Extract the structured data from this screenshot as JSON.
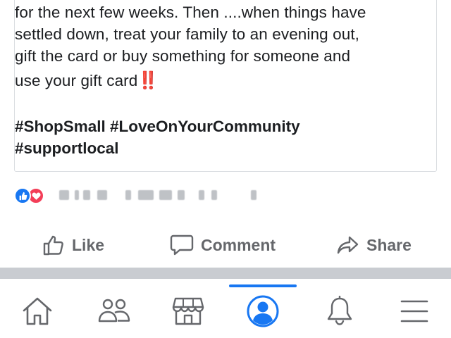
{
  "post": {
    "lines": [
      "for the next few weeks. Then ....when things have",
      "settled down, treat your family to an evening out,",
      "gift the card or buy something for someone and",
      "use your gift card"
    ],
    "emphasis": "‼️",
    "hashtags": [
      "#ShopSmall #LoveOnYourCommunity",
      "#supportlocal"
    ]
  },
  "reactions": {
    "icons": [
      "like-reaction-icon",
      "love-reaction-icon"
    ],
    "colors": {
      "like": "#1877f2",
      "love": "#f33e58"
    }
  },
  "actions": {
    "like_label": "Like",
    "comment_label": "Comment",
    "share_label": "Share"
  },
  "tab_bar": {
    "tabs": [
      "home-icon",
      "friends-icon",
      "marketplace-icon",
      "profile-icon",
      "notifications-icon",
      "menu-icon"
    ],
    "active": "profile-icon",
    "accent": "#1877f2",
    "inactive_color": "#65676b"
  }
}
